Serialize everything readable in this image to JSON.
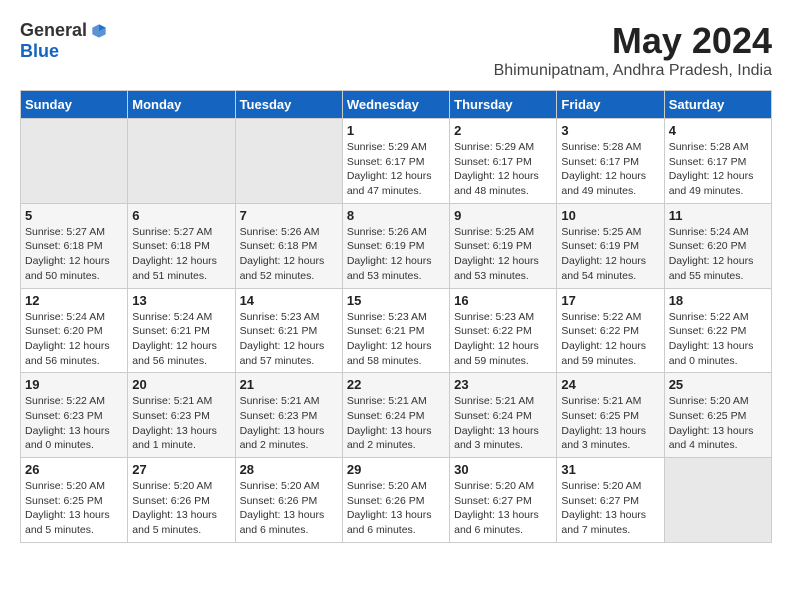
{
  "logo": {
    "general": "General",
    "blue": "Blue"
  },
  "title": "May 2024",
  "subtitle": "Bhimunipatnam, Andhra Pradesh, India",
  "weekdays": [
    "Sunday",
    "Monday",
    "Tuesday",
    "Wednesday",
    "Thursday",
    "Friday",
    "Saturday"
  ],
  "weeks": [
    [
      {
        "day": "",
        "sunrise": "",
        "sunset": "",
        "daylight": ""
      },
      {
        "day": "",
        "sunrise": "",
        "sunset": "",
        "daylight": ""
      },
      {
        "day": "",
        "sunrise": "",
        "sunset": "",
        "daylight": ""
      },
      {
        "day": "1",
        "sunrise": "Sunrise: 5:29 AM",
        "sunset": "Sunset: 6:17 PM",
        "daylight": "Daylight: 12 hours and 47 minutes."
      },
      {
        "day": "2",
        "sunrise": "Sunrise: 5:29 AM",
        "sunset": "Sunset: 6:17 PM",
        "daylight": "Daylight: 12 hours and 48 minutes."
      },
      {
        "day": "3",
        "sunrise": "Sunrise: 5:28 AM",
        "sunset": "Sunset: 6:17 PM",
        "daylight": "Daylight: 12 hours and 49 minutes."
      },
      {
        "day": "4",
        "sunrise": "Sunrise: 5:28 AM",
        "sunset": "Sunset: 6:17 PM",
        "daylight": "Daylight: 12 hours and 49 minutes."
      }
    ],
    [
      {
        "day": "5",
        "sunrise": "Sunrise: 5:27 AM",
        "sunset": "Sunset: 6:18 PM",
        "daylight": "Daylight: 12 hours and 50 minutes."
      },
      {
        "day": "6",
        "sunrise": "Sunrise: 5:27 AM",
        "sunset": "Sunset: 6:18 PM",
        "daylight": "Daylight: 12 hours and 51 minutes."
      },
      {
        "day": "7",
        "sunrise": "Sunrise: 5:26 AM",
        "sunset": "Sunset: 6:18 PM",
        "daylight": "Daylight: 12 hours and 52 minutes."
      },
      {
        "day": "8",
        "sunrise": "Sunrise: 5:26 AM",
        "sunset": "Sunset: 6:19 PM",
        "daylight": "Daylight: 12 hours and 53 minutes."
      },
      {
        "day": "9",
        "sunrise": "Sunrise: 5:25 AM",
        "sunset": "Sunset: 6:19 PM",
        "daylight": "Daylight: 12 hours and 53 minutes."
      },
      {
        "day": "10",
        "sunrise": "Sunrise: 5:25 AM",
        "sunset": "Sunset: 6:19 PM",
        "daylight": "Daylight: 12 hours and 54 minutes."
      },
      {
        "day": "11",
        "sunrise": "Sunrise: 5:24 AM",
        "sunset": "Sunset: 6:20 PM",
        "daylight": "Daylight: 12 hours and 55 minutes."
      }
    ],
    [
      {
        "day": "12",
        "sunrise": "Sunrise: 5:24 AM",
        "sunset": "Sunset: 6:20 PM",
        "daylight": "Daylight: 12 hours and 56 minutes."
      },
      {
        "day": "13",
        "sunrise": "Sunrise: 5:24 AM",
        "sunset": "Sunset: 6:21 PM",
        "daylight": "Daylight: 12 hours and 56 minutes."
      },
      {
        "day": "14",
        "sunrise": "Sunrise: 5:23 AM",
        "sunset": "Sunset: 6:21 PM",
        "daylight": "Daylight: 12 hours and 57 minutes."
      },
      {
        "day": "15",
        "sunrise": "Sunrise: 5:23 AM",
        "sunset": "Sunset: 6:21 PM",
        "daylight": "Daylight: 12 hours and 58 minutes."
      },
      {
        "day": "16",
        "sunrise": "Sunrise: 5:23 AM",
        "sunset": "Sunset: 6:22 PM",
        "daylight": "Daylight: 12 hours and 59 minutes."
      },
      {
        "day": "17",
        "sunrise": "Sunrise: 5:22 AM",
        "sunset": "Sunset: 6:22 PM",
        "daylight": "Daylight: 12 hours and 59 minutes."
      },
      {
        "day": "18",
        "sunrise": "Sunrise: 5:22 AM",
        "sunset": "Sunset: 6:22 PM",
        "daylight": "Daylight: 13 hours and 0 minutes."
      }
    ],
    [
      {
        "day": "19",
        "sunrise": "Sunrise: 5:22 AM",
        "sunset": "Sunset: 6:23 PM",
        "daylight": "Daylight: 13 hours and 0 minutes."
      },
      {
        "day": "20",
        "sunrise": "Sunrise: 5:21 AM",
        "sunset": "Sunset: 6:23 PM",
        "daylight": "Daylight: 13 hours and 1 minute."
      },
      {
        "day": "21",
        "sunrise": "Sunrise: 5:21 AM",
        "sunset": "Sunset: 6:23 PM",
        "daylight": "Daylight: 13 hours and 2 minutes."
      },
      {
        "day": "22",
        "sunrise": "Sunrise: 5:21 AM",
        "sunset": "Sunset: 6:24 PM",
        "daylight": "Daylight: 13 hours and 2 minutes."
      },
      {
        "day": "23",
        "sunrise": "Sunrise: 5:21 AM",
        "sunset": "Sunset: 6:24 PM",
        "daylight": "Daylight: 13 hours and 3 minutes."
      },
      {
        "day": "24",
        "sunrise": "Sunrise: 5:21 AM",
        "sunset": "Sunset: 6:25 PM",
        "daylight": "Daylight: 13 hours and 3 minutes."
      },
      {
        "day": "25",
        "sunrise": "Sunrise: 5:20 AM",
        "sunset": "Sunset: 6:25 PM",
        "daylight": "Daylight: 13 hours and 4 minutes."
      }
    ],
    [
      {
        "day": "26",
        "sunrise": "Sunrise: 5:20 AM",
        "sunset": "Sunset: 6:25 PM",
        "daylight": "Daylight: 13 hours and 5 minutes."
      },
      {
        "day": "27",
        "sunrise": "Sunrise: 5:20 AM",
        "sunset": "Sunset: 6:26 PM",
        "daylight": "Daylight: 13 hours and 5 minutes."
      },
      {
        "day": "28",
        "sunrise": "Sunrise: 5:20 AM",
        "sunset": "Sunset: 6:26 PM",
        "daylight": "Daylight: 13 hours and 6 minutes."
      },
      {
        "day": "29",
        "sunrise": "Sunrise: 5:20 AM",
        "sunset": "Sunset: 6:26 PM",
        "daylight": "Daylight: 13 hours and 6 minutes."
      },
      {
        "day": "30",
        "sunrise": "Sunrise: 5:20 AM",
        "sunset": "Sunset: 6:27 PM",
        "daylight": "Daylight: 13 hours and 6 minutes."
      },
      {
        "day": "31",
        "sunrise": "Sunrise: 5:20 AM",
        "sunset": "Sunset: 6:27 PM",
        "daylight": "Daylight: 13 hours and 7 minutes."
      },
      {
        "day": "",
        "sunrise": "",
        "sunset": "",
        "daylight": ""
      }
    ]
  ]
}
